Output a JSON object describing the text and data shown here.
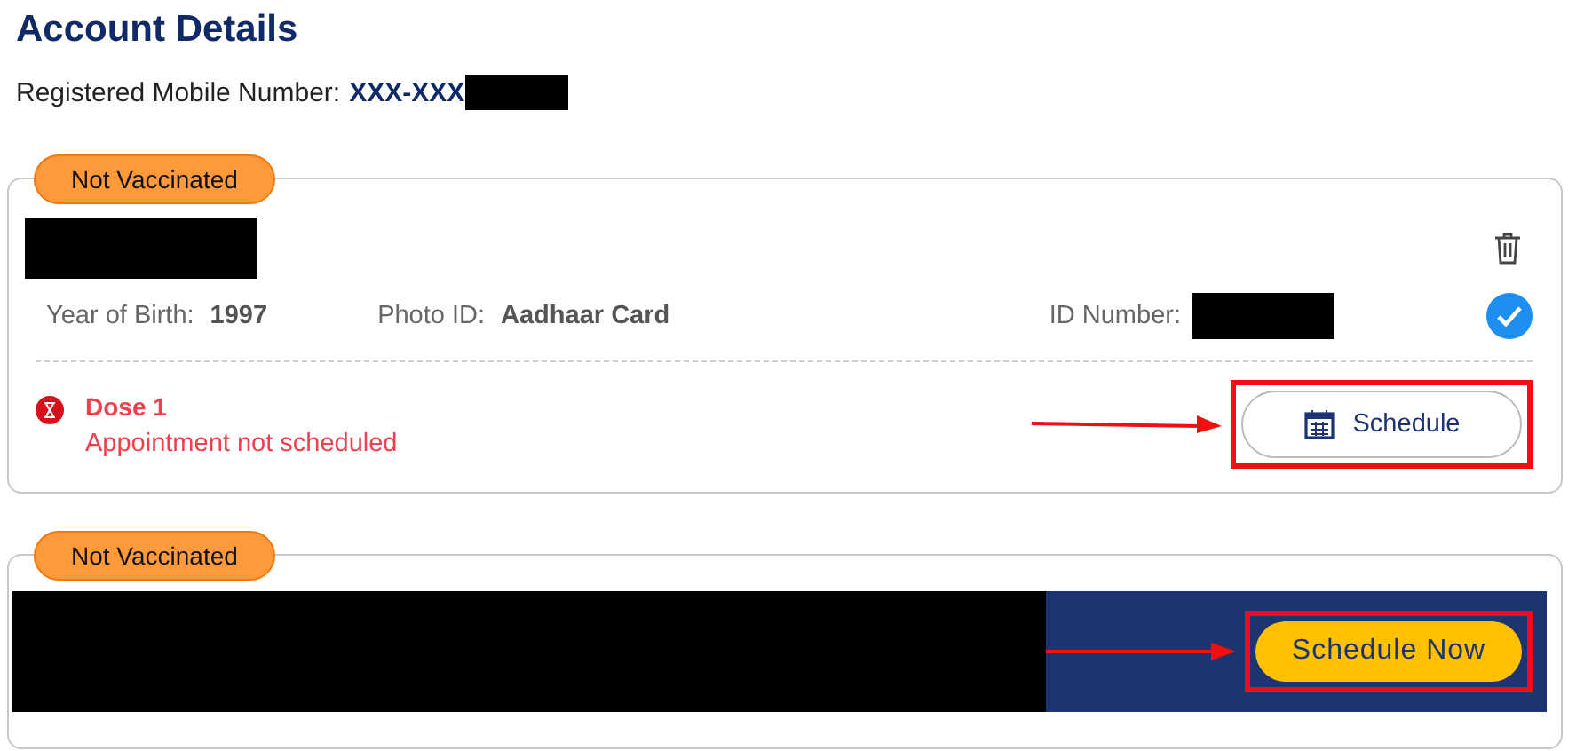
{
  "header": {
    "title": "Account Details",
    "mobile_label": "Registered Mobile Number:",
    "mobile_value": "XXX-XXX"
  },
  "beneficiaries": [
    {
      "kind": "detail",
      "status": "Not Vaccinated",
      "verified": true,
      "fields": [
        {
          "label": "Year of Birth:",
          "value": "1997"
        },
        {
          "label": "Photo ID:",
          "value": "Aadhaar Card"
        },
        {
          "label": "ID Number:"
        }
      ],
      "dose": {
        "title": "Dose 1",
        "status": "Appointment not scheduled"
      },
      "button": "Schedule"
    },
    {
      "kind": "banner",
      "status": "Not Vaccinated",
      "button": "Schedule Now"
    }
  ]
}
